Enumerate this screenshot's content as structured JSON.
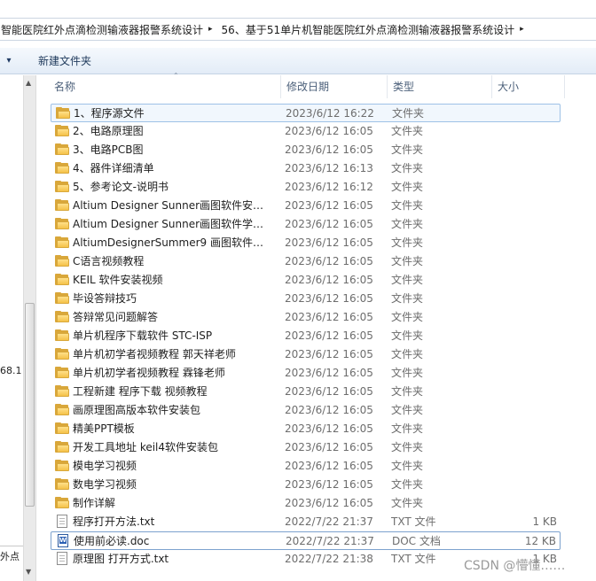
{
  "address": {
    "segments": [
      "智能医院红外点滴检测输液器报警系统设计",
      "56、基于51单片机智能医院红外点滴检测输液器报警系统设计"
    ],
    "separator": "▸"
  },
  "toolbar": {
    "organize_dropdown": "▾",
    "new_folder_label": "新建文件夹"
  },
  "nav": {
    "partial_text_1": "68.1",
    "partial_text_2": "外点"
  },
  "columns": {
    "name": "名称",
    "date": "修改日期",
    "type": "类型",
    "size": "大小"
  },
  "files": [
    {
      "name": "1、程序源文件",
      "date": "2023/6/12 16:22",
      "type": "文件夹",
      "size": "",
      "icon": "folder-icon"
    },
    {
      "name": "2、电路原理图",
      "date": "2023/6/12 16:05",
      "type": "文件夹",
      "size": "",
      "icon": "folder-icon"
    },
    {
      "name": "3、电路PCB图",
      "date": "2023/6/12 16:05",
      "type": "文件夹",
      "size": "",
      "icon": "folder-icon"
    },
    {
      "name": "4、器件详细清单",
      "date": "2023/6/12 16:13",
      "type": "文件夹",
      "size": "",
      "icon": "folder-icon"
    },
    {
      "name": "5、参考论文-说明书",
      "date": "2023/6/12 16:12",
      "type": "文件夹",
      "size": "",
      "icon": "folder-icon"
    },
    {
      "name": "Altium Designer Sunner画图软件安装...",
      "date": "2023/6/12 16:05",
      "type": "文件夹",
      "size": "",
      "icon": "folder-icon"
    },
    {
      "name": "Altium Designer Sunner画图软件学习...",
      "date": "2023/6/12 16:05",
      "type": "文件夹",
      "size": "",
      "icon": "folder-icon"
    },
    {
      "name": "AltiumDesignerSummer9 画图软件安...",
      "date": "2023/6/12 16:05",
      "type": "文件夹",
      "size": "",
      "icon": "folder-icon"
    },
    {
      "name": "C语言视频教程",
      "date": "2023/6/12 16:05",
      "type": "文件夹",
      "size": "",
      "icon": "folder-icon"
    },
    {
      "name": "KEIL 软件安装视频",
      "date": "2023/6/12 16:05",
      "type": "文件夹",
      "size": "",
      "icon": "folder-icon"
    },
    {
      "name": "毕设答辩技巧",
      "date": "2023/6/12 16:05",
      "type": "文件夹",
      "size": "",
      "icon": "folder-icon"
    },
    {
      "name": "答辩常见问题解答",
      "date": "2023/6/12 16:05",
      "type": "文件夹",
      "size": "",
      "icon": "folder-icon"
    },
    {
      "name": "单片机程序下载软件 STC-ISP",
      "date": "2023/6/12 16:05",
      "type": "文件夹",
      "size": "",
      "icon": "folder-icon"
    },
    {
      "name": "单片机初学者视频教程 郭天祥老师",
      "date": "2023/6/12 16:05",
      "type": "文件夹",
      "size": "",
      "icon": "folder-icon"
    },
    {
      "name": "单片机初学者视频教程 霖锋老师",
      "date": "2023/6/12 16:05",
      "type": "文件夹",
      "size": "",
      "icon": "folder-icon"
    },
    {
      "name": "工程新建 程序下载 视频教程",
      "date": "2023/6/12 16:05",
      "type": "文件夹",
      "size": "",
      "icon": "folder-icon"
    },
    {
      "name": "画原理图高版本软件安装包",
      "date": "2023/6/12 16:05",
      "type": "文件夹",
      "size": "",
      "icon": "folder-icon"
    },
    {
      "name": "精美PPT模板",
      "date": "2023/6/12 16:05",
      "type": "文件夹",
      "size": "",
      "icon": "folder-icon"
    },
    {
      "name": "开发工具地址 keil4软件安装包",
      "date": "2023/6/12 16:05",
      "type": "文件夹",
      "size": "",
      "icon": "folder-icon"
    },
    {
      "name": "模电学习视频",
      "date": "2023/6/12 16:05",
      "type": "文件夹",
      "size": "",
      "icon": "folder-icon"
    },
    {
      "name": "数电学习视频",
      "date": "2023/6/12 16:05",
      "type": "文件夹",
      "size": "",
      "icon": "folder-icon"
    },
    {
      "name": "制作详解",
      "date": "2023/6/12 16:05",
      "type": "文件夹",
      "size": "",
      "icon": "folder-icon"
    },
    {
      "name": "程序打开方法.txt",
      "date": "2022/7/22 21:37",
      "type": "TXT 文件",
      "size": "1 KB",
      "icon": "text-file-icon"
    },
    {
      "name": "使用前必读.doc",
      "date": "2022/7/22 21:37",
      "type": "DOC 文档",
      "size": "12 KB",
      "icon": "word-doc-icon"
    },
    {
      "name": "原理图 打开方式.txt",
      "date": "2022/7/22 21:38",
      "type": "TXT 文件",
      "size": "1 KB",
      "icon": "text-file-icon"
    }
  ],
  "watermark": "CSDN @懵懂……"
}
